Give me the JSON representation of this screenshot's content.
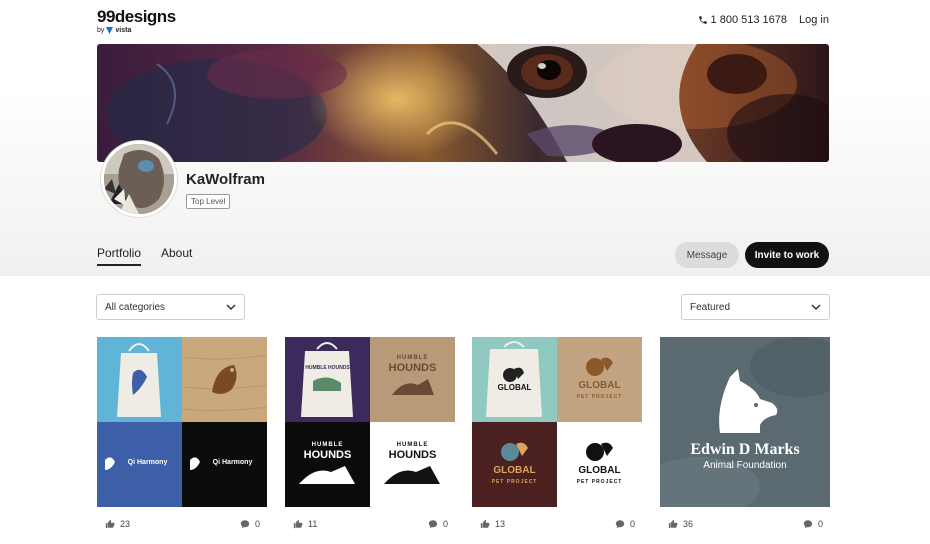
{
  "header": {
    "logo": "99designs",
    "logo_by": "by",
    "logo_brand": "vista",
    "phone": "1 800 513 1678",
    "login": "Log in"
  },
  "profile": {
    "name": "KaWolfram",
    "level": "Top Level"
  },
  "tabs": [
    {
      "label": "Portfolio",
      "active": true
    },
    {
      "label": "About",
      "active": false
    }
  ],
  "actions": {
    "message": "Message",
    "invite": "Invite to work"
  },
  "filters": {
    "category": "All categories",
    "sort": "Featured"
  },
  "portfolio": [
    {
      "texts": {
        "q3": "Qi Harmony",
        "q4": "Qi Harmony"
      },
      "likes": "23",
      "comments": "0"
    },
    {
      "texts": {
        "q2a": "HUMBLE",
        "q2b": "HOUNDS",
        "q3a": "HUMBLE",
        "q3b": "HOUNDS",
        "q4a": "HUMBLE",
        "q4b": "HOUNDS",
        "tote": "HUMBLE HOUNDS"
      },
      "likes": "11",
      "comments": "0"
    },
    {
      "texts": {
        "q1": "GLOBAL",
        "q2": "GLOBAL",
        "q3": "GLOBAL",
        "q4": "GLOBAL",
        "sub": "PET PROJECT"
      },
      "likes": "13",
      "comments": "0"
    },
    {
      "texts": {
        "title": "Edwin D Marks",
        "subtitle": "Animal Foundation"
      },
      "likes": "36",
      "comments": "0"
    }
  ],
  "colors": {
    "accent_dark": "#111111",
    "qi_blue": "#3c5fa8",
    "qi_sky": "#5fb4d8",
    "hounds_purple": "#3b2a5c",
    "global_maroon": "#4a2020",
    "edwin_gray": "#5a6a70"
  }
}
